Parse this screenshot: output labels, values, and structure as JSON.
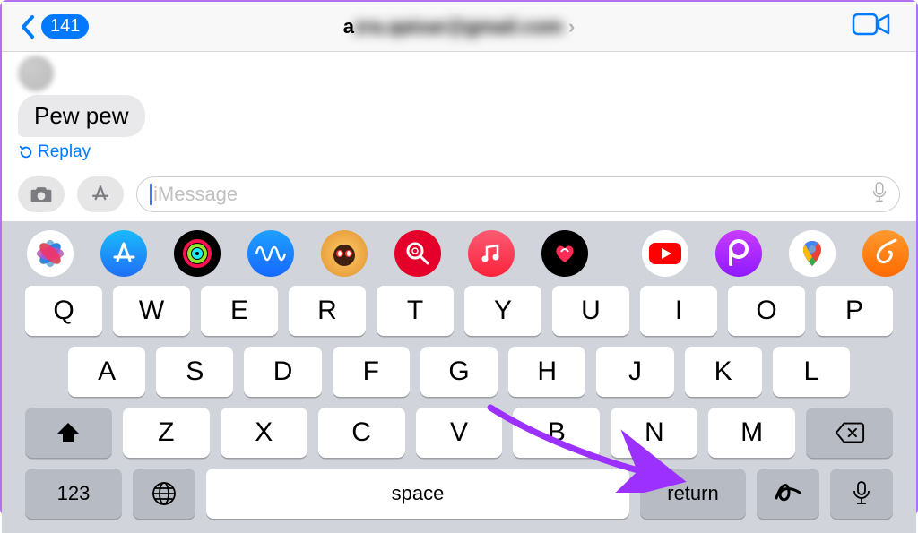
{
  "header": {
    "badge_count": "141",
    "contact_prefix": "a",
    "contact_blurred": "zra.qaisar@gmail.com"
  },
  "conversation": {
    "bubble_text": "Pew pew",
    "replay_label": "Replay"
  },
  "composer": {
    "placeholder": "iMessage"
  },
  "app_strip_names": [
    "photos",
    "app-store",
    "fitness",
    "voice-memos",
    "memoji",
    "search",
    "music",
    "digital-touch",
    "youtube",
    "picsart",
    "google-maps",
    "garageband"
  ],
  "keyboard": {
    "row1": [
      "Q",
      "W",
      "E",
      "R",
      "T",
      "Y",
      "U",
      "I",
      "O",
      "P"
    ],
    "row2": [
      "A",
      "S",
      "D",
      "F",
      "G",
      "H",
      "J",
      "K",
      "L"
    ],
    "row3": [
      "Z",
      "X",
      "C",
      "V",
      "B",
      "N",
      "M"
    ],
    "num_key": "123",
    "space_label": "space",
    "return_label": "return"
  }
}
